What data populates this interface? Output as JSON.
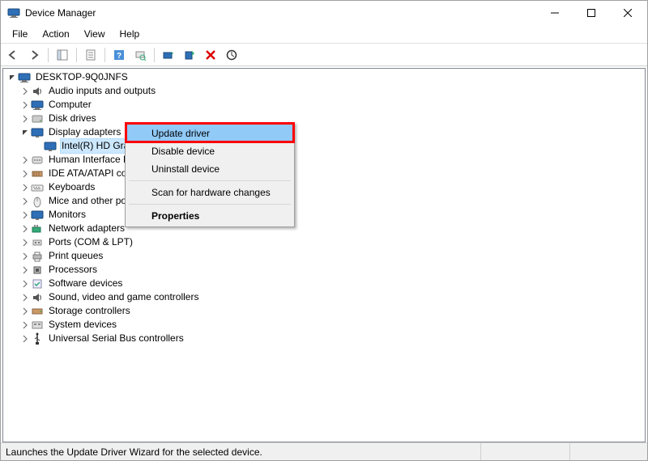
{
  "window": {
    "title": "Device Manager"
  },
  "menubar": {
    "items": [
      "File",
      "Action",
      "View",
      "Help"
    ]
  },
  "tree": {
    "root": "DESKTOP-9Q0JNFS",
    "categories": [
      {
        "label": "Audio inputs and outputs",
        "icon": "audio"
      },
      {
        "label": "Computer",
        "icon": "computer"
      },
      {
        "label": "Disk drives",
        "icon": "disk"
      },
      {
        "label": "Display adapters",
        "icon": "display",
        "expanded": true,
        "children": [
          {
            "label": "Intel(R) HD Graphics 400",
            "icon": "display",
            "selected": true
          }
        ]
      },
      {
        "label": "Human Interface Devices",
        "icon": "hid"
      },
      {
        "label": "IDE ATA/ATAPI controllers",
        "icon": "ide"
      },
      {
        "label": "Keyboards",
        "icon": "keyboard"
      },
      {
        "label": "Mice and other pointing devices",
        "icon": "mouse"
      },
      {
        "label": "Monitors",
        "icon": "monitor"
      },
      {
        "label": "Network adapters",
        "icon": "network"
      },
      {
        "label": "Ports (COM & LPT)",
        "icon": "port"
      },
      {
        "label": "Print queues",
        "icon": "printer"
      },
      {
        "label": "Processors",
        "icon": "cpu"
      },
      {
        "label": "Software devices",
        "icon": "software"
      },
      {
        "label": "Sound, video and game controllers",
        "icon": "sound"
      },
      {
        "label": "Storage controllers",
        "icon": "storage"
      },
      {
        "label": "System devices",
        "icon": "system"
      },
      {
        "label": "Universal Serial Bus controllers",
        "icon": "usb"
      }
    ]
  },
  "context_menu": {
    "items": [
      {
        "label": "Update driver",
        "highlighted": true
      },
      {
        "label": "Disable device"
      },
      {
        "label": "Uninstall device"
      },
      {
        "sep": true
      },
      {
        "label": "Scan for hardware changes"
      },
      {
        "sep": true
      },
      {
        "label": "Properties",
        "bold": true
      }
    ]
  },
  "statusbar": {
    "text": "Launches the Update Driver Wizard for the selected device."
  }
}
